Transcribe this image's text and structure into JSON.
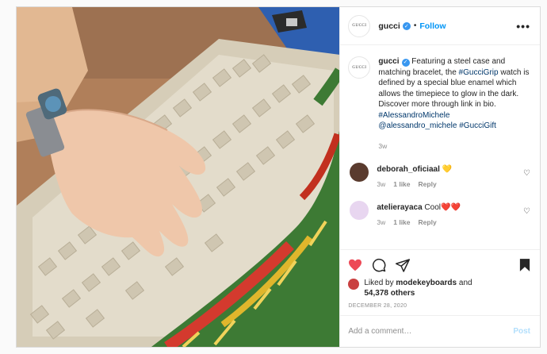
{
  "post": {
    "image_alt": "Hand typing on vintage keyboard wearing GucciGrip watch with tinsel",
    "header": {
      "username": "gucci",
      "verified_icon": "verified-badge-icon",
      "separator": "•",
      "follow_label": "Follow",
      "more_label": "•••"
    },
    "avatar_text": "GUCCI",
    "caption": {
      "username": "gucci",
      "text_1": " Featuring a steel case and matching bracelet, the ",
      "tag_1": "#GucciGrip",
      "text_2": " watch is defined by a special blue enamel which allows the timepiece to glow in the dark. Discover more through link in bio. ",
      "tag_2": "#AlessandroMichele",
      "mention": "@alessandro_michele",
      "tag_3": "#GucciGift",
      "age": "3w"
    },
    "comments": [
      {
        "username": "deborah_oficiaal",
        "text": " 💛",
        "age": "3w",
        "likes": "1 like",
        "reply": "Reply",
        "avatar_color": "#5a3b2e"
      },
      {
        "username": "atelierayaca",
        "text": " Cool❤️❤️",
        "age": "3w",
        "likes": "1 like",
        "reply": "Reply",
        "avatar_color": "#e8d6f0"
      }
    ],
    "likes": {
      "prefix": "Liked by ",
      "user": "modekeyboards",
      "middle": " and",
      "count": "54,378 others"
    },
    "date": "DECEMBER 28, 2020",
    "add_comment": {
      "placeholder": "Add a comment…",
      "post_label": "Post"
    },
    "colors": {
      "accent": "#0095f6",
      "like": "#ed4956"
    }
  }
}
